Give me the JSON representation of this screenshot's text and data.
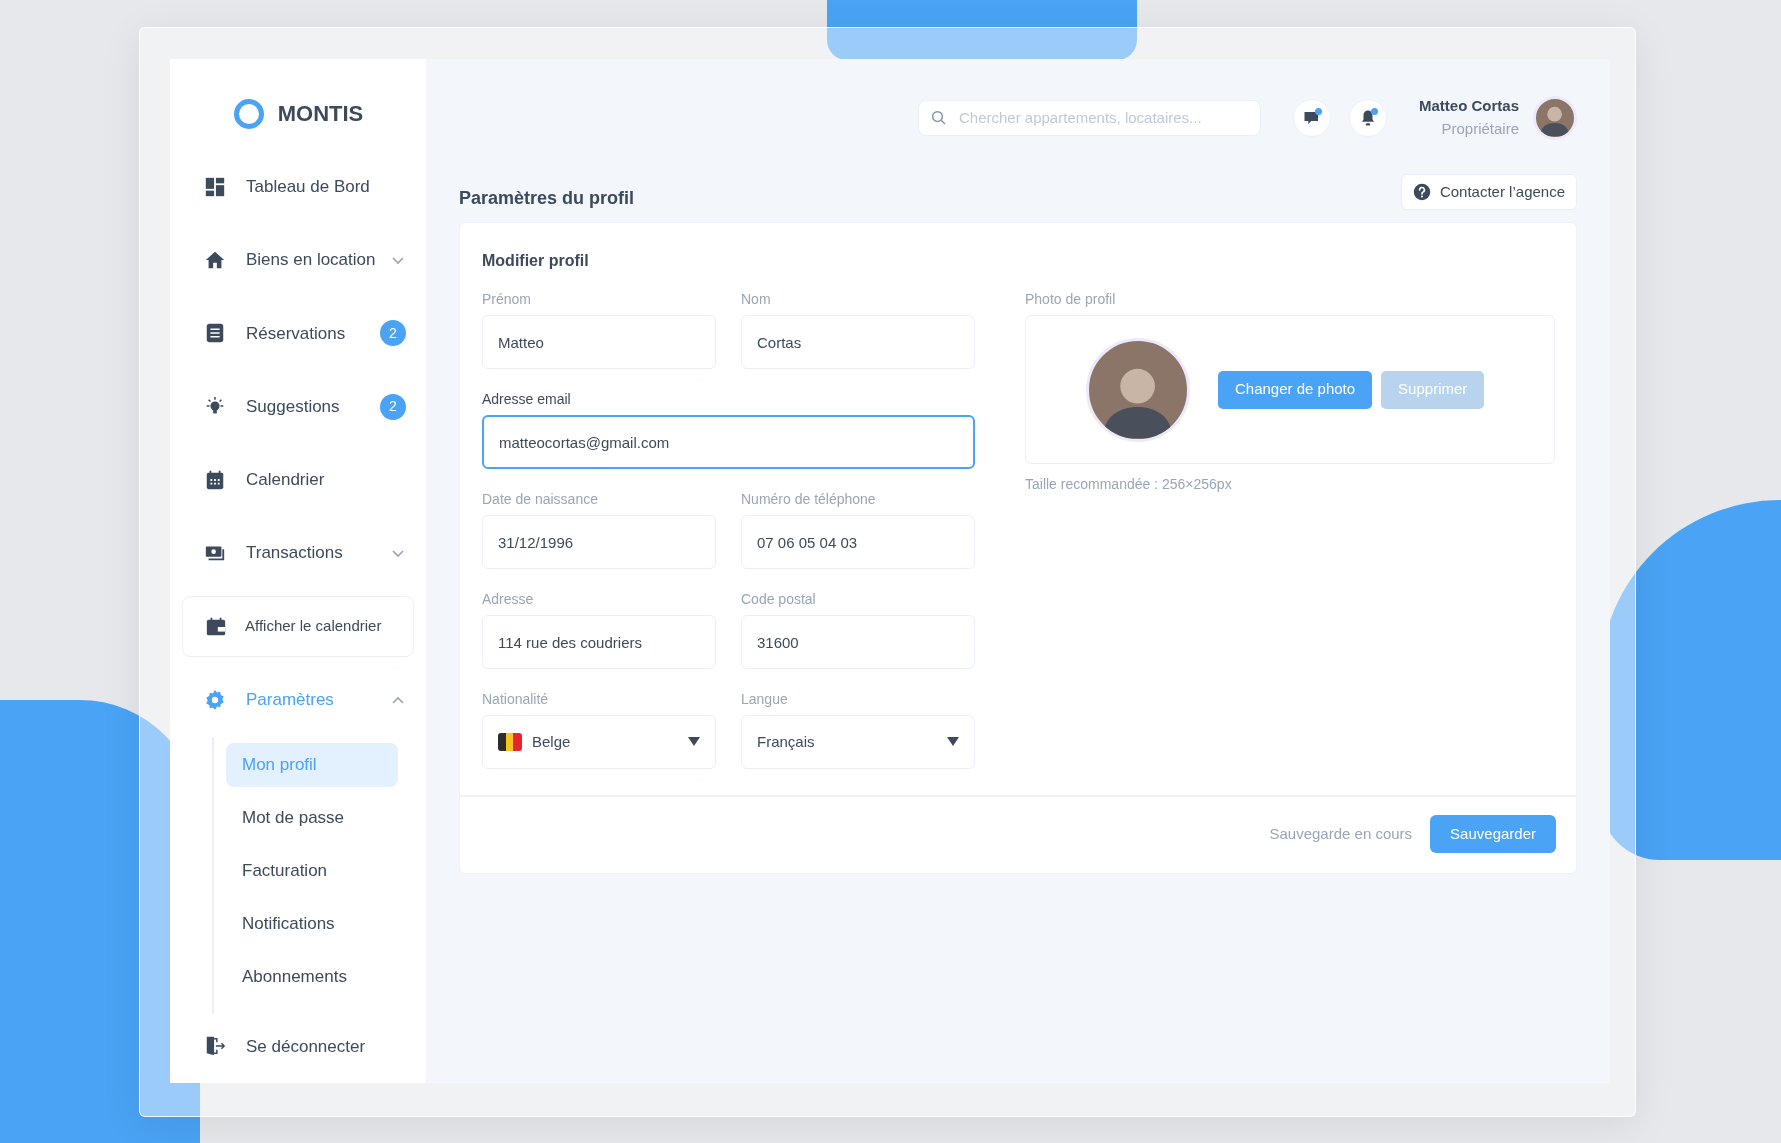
{
  "logo": {
    "text": "MONTIS"
  },
  "sidebar": {
    "items": [
      {
        "label": "Tableau de Bord",
        "selected": false
      },
      {
        "label": "Biens en location",
        "selected": false,
        "expanded": false
      },
      {
        "label": "Réservations",
        "selected": false,
        "badge": "2"
      },
      {
        "label": "Suggestions",
        "selected": false,
        "badge": "2"
      },
      {
        "label": "Calendrier",
        "selected": false
      },
      {
        "label": "Transactions",
        "selected": false,
        "expanded": false
      }
    ],
    "calendar_button": "Afficher le calendrier",
    "settings": {
      "label": "Paramètres",
      "selected": true,
      "expanded": true,
      "children": [
        {
          "label": "Mon profil",
          "selected": true
        },
        {
          "label": "Mot de passe",
          "selected": false
        },
        {
          "label": "Facturation",
          "selected": false
        },
        {
          "label": "Notifications",
          "selected": false
        },
        {
          "label": "Abonnements",
          "selected": false
        }
      ]
    },
    "logout": "Se déconnecter"
  },
  "topbar": {
    "search": {
      "placeholder": "Chercher appartements, locataires..."
    },
    "messages_unread": true,
    "notifications_unread": true,
    "user": {
      "name": "Matteo Cortas",
      "role": "Propriétaire"
    }
  },
  "page": {
    "title": "Paramètres du profil",
    "contact_button": "Contacter l’agence"
  },
  "form": {
    "title": "Modifier profil",
    "rows": [
      [
        {
          "label": "Prénom",
          "value": "Matteo",
          "kind": "text",
          "focused": false
        },
        {
          "label": "Nom",
          "value": "Cortas",
          "kind": "text",
          "focused": false
        }
      ],
      [
        {
          "label": "Adresse email",
          "value": "matteocortas@gmail.com",
          "kind": "text",
          "focused": true
        }
      ],
      [
        {
          "label": "Date de naissance",
          "value": "31/12/1996",
          "kind": "text",
          "focused": false
        },
        {
          "label": "Numéro de téléphone",
          "value": "07 06 05 04 03",
          "kind": "text",
          "focused": false
        }
      ],
      [
        {
          "label": "Adresse",
          "value": "114 rue des coudriers",
          "kind": "text",
          "focused": false
        },
        {
          "label": "Code postal",
          "value": "31600",
          "kind": "text",
          "focused": false
        }
      ],
      [
        {
          "label": "Nationalité",
          "value": "Belge",
          "kind": "select",
          "flag": true,
          "focused": false
        },
        {
          "label": "Langue",
          "value": "Français",
          "kind": "select",
          "focused": false
        }
      ]
    ],
    "photo": {
      "label": "Photo de profil",
      "buttons": [
        {
          "label": "Changer de photo",
          "disabled": false
        },
        {
          "label": "Supprimer",
          "disabled": true
        }
      ],
      "hint": "Taille recommandée : 256×256px"
    },
    "status": "Sauvegarde en cours",
    "save_button": "Sauvegarder"
  }
}
